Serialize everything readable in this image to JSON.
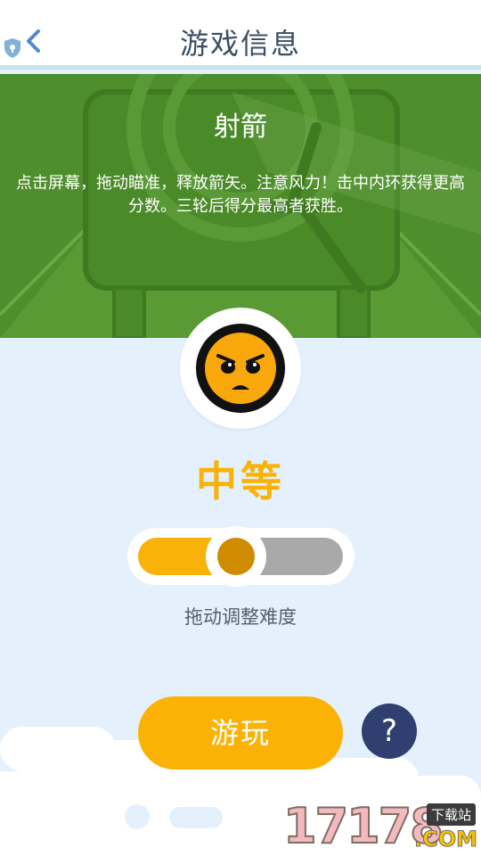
{
  "header": {
    "title": "游戏信息",
    "back_icon": "chevron-left-icon",
    "badge_icon": "shield-icon"
  },
  "game": {
    "name": "射箭",
    "description": "点击屏幕，拖动瞄准，释放箭矢。注意风力！击中内环获得更高分数。三轮后得分最高者获胜。",
    "banner_color": "#4e8e2c"
  },
  "difficulty": {
    "label": "中等",
    "level_fraction": 0.5,
    "hint": "拖动调整难度",
    "accent_color": "#f9b208"
  },
  "actions": {
    "play_label": "游玩",
    "help_label": "?"
  },
  "watermark": {
    "digits": "17178",
    "tag": "下载站",
    "suffix": ".COM"
  }
}
